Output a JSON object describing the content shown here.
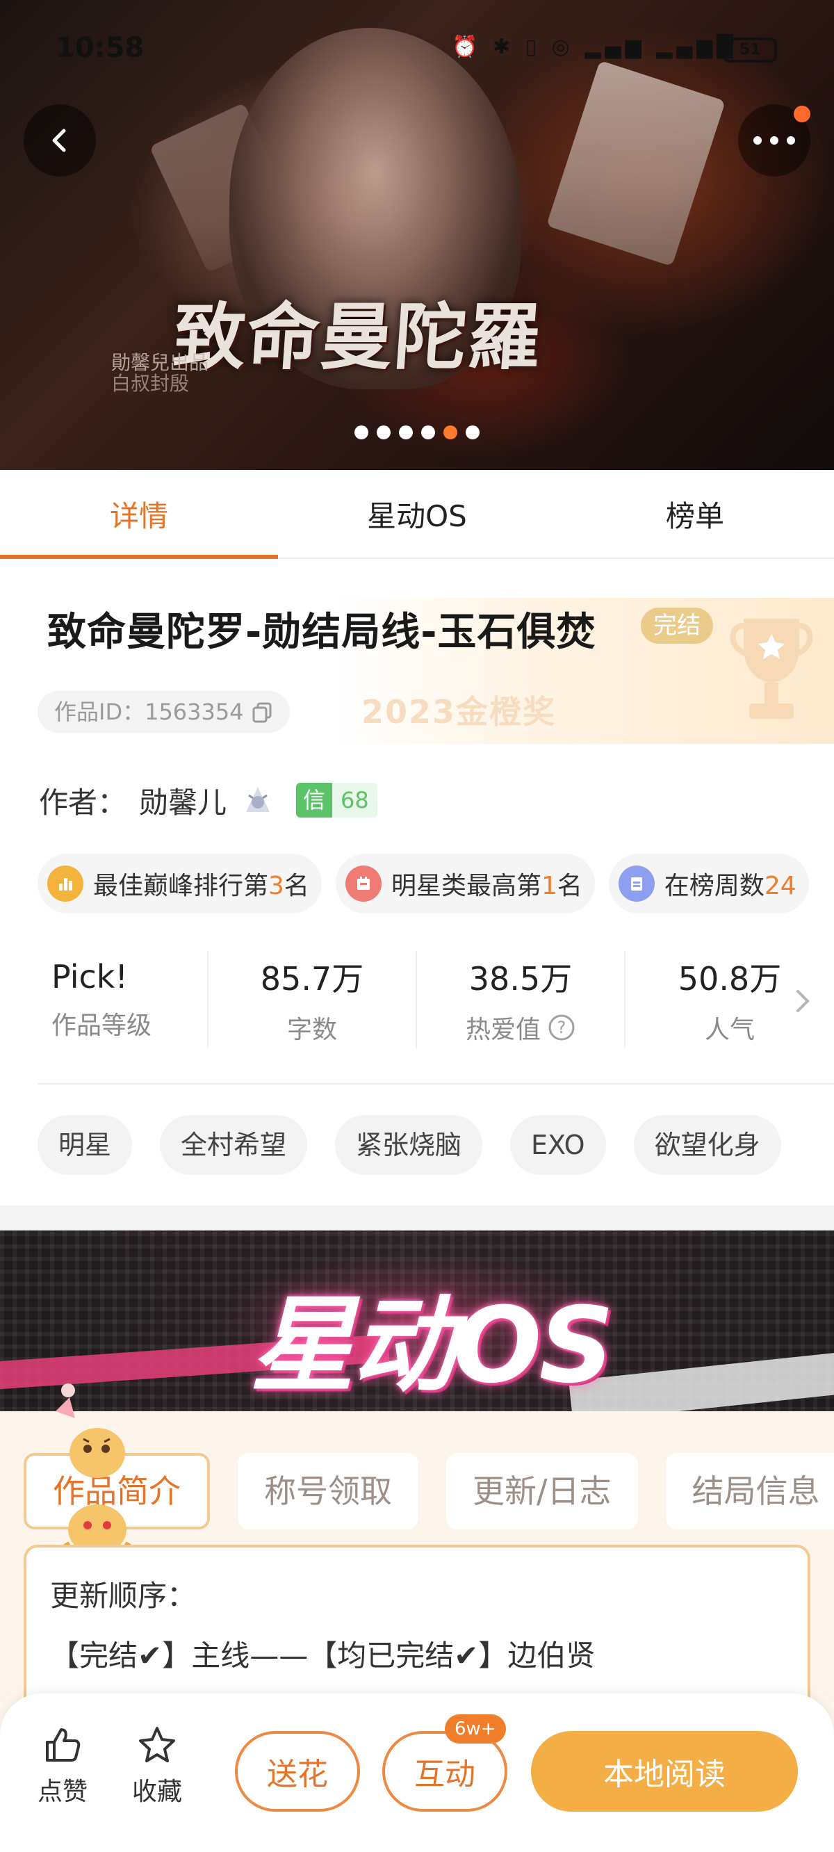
{
  "status_bar": {
    "time": "10:58",
    "icons_text": "⏰ ✱ ▯ ◎ ▂▄▆ ▂▄▆█",
    "battery": "51"
  },
  "hero": {
    "title": "致命曼陀羅",
    "subtitle_1": "勛馨兒出品",
    "subtitle_2": "白叔封殷",
    "carousel_count": 6,
    "carousel_active_index": 4
  },
  "tabs": [
    {
      "label": "详情",
      "active": true
    },
    {
      "label": "星动OS",
      "active": false
    },
    {
      "label": "榜单",
      "active": false
    }
  ],
  "book": {
    "title": "致命曼陀罗-勋结局线-玉石俱焚",
    "status_badge": "完结",
    "work_id": "作品ID：1563354",
    "award": "2023金橙奖",
    "author_label": "作者：",
    "author_name": "勋馨儿",
    "credit_key": "信",
    "credit_value": "68"
  },
  "rankings": [
    {
      "prefix": "最佳巅峰排行第",
      "num": "3",
      "suffix": "名",
      "icon_color": "#f3b33d"
    },
    {
      "prefix": "明星类最高第",
      "num": "1",
      "suffix": "名",
      "icon_color": "#f07a74"
    },
    {
      "prefix": "在榜周数",
      "num": "24",
      "suffix": "",
      "icon_color": "#8c9ff0"
    }
  ],
  "stats": [
    {
      "value": "Pick!",
      "label": "作品等级"
    },
    {
      "value": "85.7万",
      "label": "字数"
    },
    {
      "value": "38.5万",
      "label": "热爱值"
    },
    {
      "value": "50.8万",
      "label": "人气"
    }
  ],
  "tags": [
    "明星",
    "全村希望",
    "紧张烧脑",
    "EXO",
    "欲望化身"
  ],
  "os_banner": {
    "title": "星动OS"
  },
  "os_tabs": [
    {
      "label": "作品简介",
      "active": true
    },
    {
      "label": "称号领取",
      "active": false
    },
    {
      "label": "更新/日志",
      "active": false
    },
    {
      "label": "结局信息",
      "active": false
    }
  ],
  "os_card": {
    "line1": "更新顺序：",
    "line2": "【完结✔】主线——【均已完结✔】边伯贤"
  },
  "bottom_bar": {
    "like_label": "点赞",
    "collect_label": "收藏",
    "flower_label": "送花",
    "interact_label": "互动",
    "interact_badge": "6w+",
    "read_label": "本地阅读"
  },
  "colors": {
    "accent": "#e5742a",
    "primary_button": "#f4ae45",
    "completed_badge": "#eacb8a",
    "credit_green": "#5cc36a"
  }
}
